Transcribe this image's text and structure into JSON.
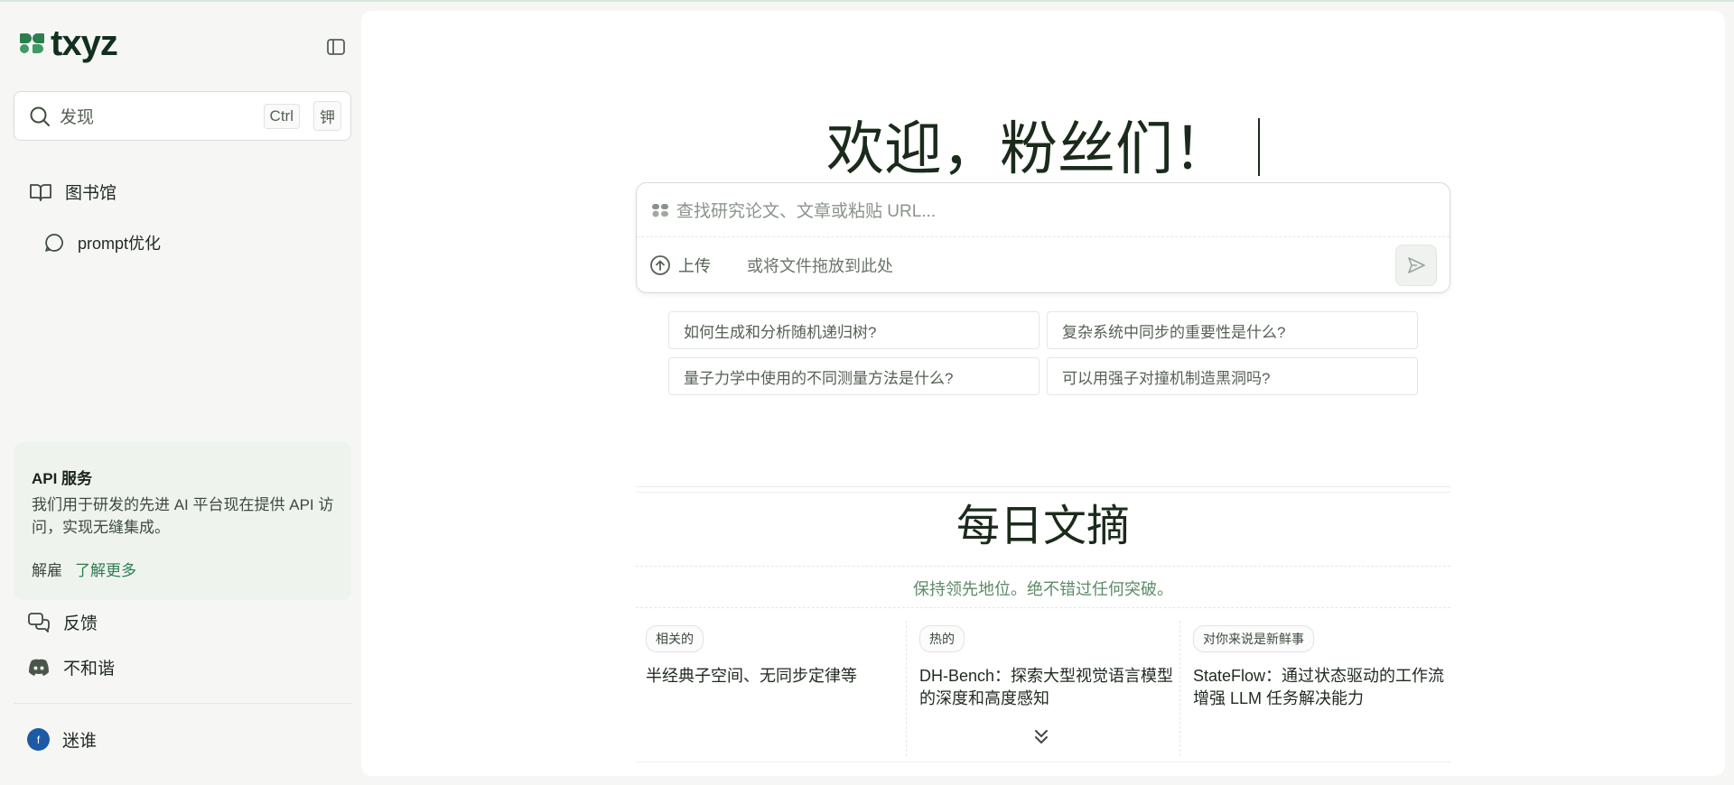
{
  "app": {
    "logo_text": "txyz",
    "brand_color": "#2e7d4f"
  },
  "sidebar": {
    "search": {
      "label": "发现",
      "shortcut_ctrl": "Ctrl",
      "shortcut_key": "钾"
    },
    "library_label": "图书馆",
    "sub_items": [
      {
        "label": "prompt优化",
        "icon": "chat-bubble-icon"
      }
    ],
    "api_card": {
      "title": "API 服务",
      "description": "我们用于研发的先进 AI 平台现在提供 API 访问，实现无缝集成。",
      "dismiss_label": "解雇",
      "learn_more_label": "了解更多"
    },
    "feedback_label": "反馈",
    "discord_label": "不和谐",
    "user": {
      "avatar_letter": "f",
      "name": "迷谁"
    }
  },
  "main": {
    "welcome": "欢迎，粉丝们！",
    "query": {
      "placeholder": "查找研究论文、文章或粘贴 URL...",
      "upload_label": "上传",
      "drop_hint": "或将文件拖放到此处"
    },
    "suggestions": [
      "如何生成和分析随机递归树?",
      "复杂系统中同步的重要性是什么?",
      "量子力学中使用的不同测量方法是什么?",
      "可以用强子对撞机制造黑洞吗?"
    ],
    "digest": {
      "title": "每日文摘",
      "subtitle": "保持领先地位。绝不错过任何突破。",
      "cards": [
        {
          "tag": "相关的",
          "title": "半经典子空间、无同步定律等"
        },
        {
          "tag": "热的",
          "title": "DH-Bench：探索大型视觉语言模型的深度和高度感知"
        },
        {
          "tag": "对你来说是新鲜事",
          "title": "StateFlow：通过状态驱动的工作流增强 LLM 任务解决能力"
        }
      ]
    }
  }
}
